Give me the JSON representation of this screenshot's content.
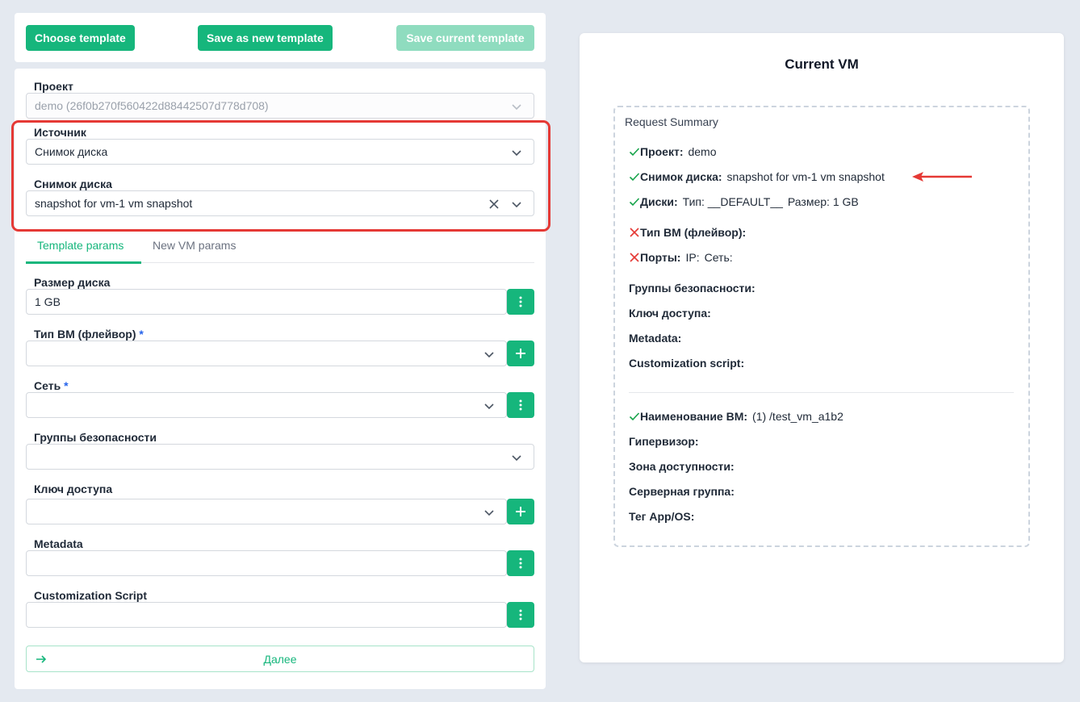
{
  "toolbar": {
    "choose_template": "Choose template",
    "save_as_new_template": "Save as new template",
    "save_current_template": "Save current template"
  },
  "form": {
    "project": {
      "label": "Проект",
      "value": "demo (26f0b270f560422d88442507d778d708)"
    },
    "source": {
      "label": "Источник",
      "value": "Снимок диска"
    },
    "snapshot": {
      "label": "Снимок диска",
      "value": "snapshot for vm-1 vm snapshot"
    },
    "tabs": [
      {
        "label": "Template params",
        "active": true
      },
      {
        "label": "New VM params",
        "active": false
      }
    ],
    "disk_size": {
      "label": "Размер диска",
      "value": "1 GB"
    },
    "flavor": {
      "label": "Тип ВМ (флейвор)",
      "required_mark": "*",
      "value": ""
    },
    "network": {
      "label": "Сеть",
      "required_mark": "*",
      "value": ""
    },
    "security_groups": {
      "label": "Группы безопасности",
      "value": ""
    },
    "access_key": {
      "label": "Ключ доступа",
      "value": ""
    },
    "metadata": {
      "label": "Metadata",
      "value": ""
    },
    "customization_script": {
      "label": "Customization Script",
      "value": ""
    },
    "next_button": "Далее"
  },
  "current_vm": {
    "title": "Current VM",
    "summary_title": "Request Summary",
    "rows": {
      "project": {
        "status": "ok",
        "label": "Проект:",
        "value": "demo"
      },
      "snapshot": {
        "status": "ok",
        "label": "Снимок диска:",
        "value": "snapshot for vm-1 vm snapshot"
      },
      "disks": {
        "status": "ok",
        "label": "Диски:",
        "type_label": "Тип:",
        "type_value": "__DEFAULT__",
        "size_label": "Размер:",
        "size_value": "1 GB"
      },
      "flavor": {
        "status": "error",
        "label": "Тип ВМ (флейвор):"
      },
      "ports": {
        "status": "error",
        "label": "Порты:",
        "ip_label": "IP:",
        "net_label": "Сеть:"
      },
      "security_groups": {
        "label": "Группы безопасности:"
      },
      "access_key": {
        "label": "Ключ доступа:"
      },
      "metadata": {
        "label": "Metadata:"
      },
      "customization_script": {
        "label": "Customization script:"
      },
      "vm_name": {
        "status": "ok",
        "label": "Наименование ВМ:",
        "value": "(1) /test_vm_a1b2"
      },
      "hypervisor": {
        "label": "Гипервизор:"
      },
      "availability_zone": {
        "label": "Зона доступности:"
      },
      "server_group": {
        "label": "Серверная группа:"
      },
      "app_os_tag": {
        "label": "Тег App/OS:"
      }
    }
  },
  "colors": {
    "accent_green": "#16b67c",
    "disabled_green": "#8fdcbf",
    "highlight_red": "#e53935",
    "check_green": "#16a34a",
    "cross_red": "#e53935",
    "required_blue": "#2563eb"
  },
  "icons": [
    "chevron-down-icon",
    "clear-icon",
    "kebab-menu-icon",
    "plus-icon",
    "arrow-right-icon",
    "check-icon",
    "cross-icon",
    "annotation-arrow"
  ]
}
